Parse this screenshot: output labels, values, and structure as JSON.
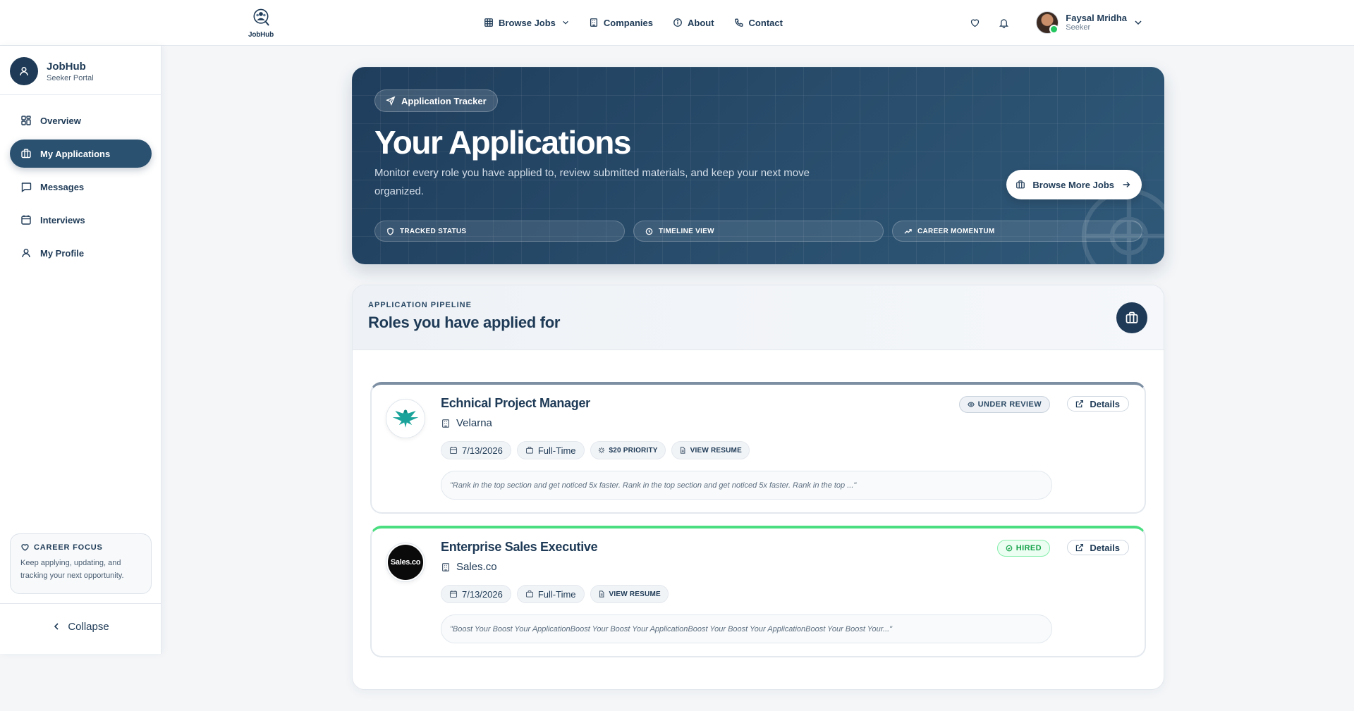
{
  "app": {
    "logo_text": "JobHub"
  },
  "topnav": {
    "links": [
      {
        "label": "Browse Jobs",
        "icon": "grid-icon"
      },
      {
        "label": "Companies",
        "icon": "building-icon"
      },
      {
        "label": "About",
        "icon": "info-icon"
      },
      {
        "label": "Contact",
        "icon": "phone-icon"
      }
    ],
    "user": {
      "name": "Faysal Mridha",
      "role": "Seeker"
    }
  },
  "sidebar": {
    "title": "JobHub",
    "subtitle": "Seeker Portal",
    "items": [
      {
        "label": "Overview",
        "icon": "dashboard-icon",
        "active": false
      },
      {
        "label": "My Applications",
        "icon": "briefcase-icon",
        "active": true
      },
      {
        "label": "Messages",
        "icon": "message-icon",
        "active": false
      },
      {
        "label": "Interviews",
        "icon": "calendar-icon",
        "active": false
      },
      {
        "label": "My Profile",
        "icon": "user-icon",
        "active": false
      }
    ],
    "focus": {
      "title": "CAREER FOCUS",
      "text": "Keep applying, updating, and tracking your next opportunity."
    },
    "collapse_label": "Collapse"
  },
  "hero": {
    "chip": "Application Tracker",
    "title": "Your Applications",
    "description": "Monitor every role you have applied to, review submitted materials, and keep your next move organized.",
    "cta": "Browse More Jobs",
    "pills": [
      "TRACKED STATUS",
      "TIMELINE VIEW",
      "CAREER MOMENTUM"
    ]
  },
  "pipeline": {
    "kicker": "APPLICATION PIPELINE",
    "title": "Roles you have applied for",
    "applications": [
      {
        "title": "Echnical Project Manager",
        "company": "Velarna",
        "date": "7/13/2026",
        "type": "Full-Time",
        "priority": "$20 PRIORITY",
        "resume": "VIEW RESUME",
        "status": "UNDER REVIEW",
        "details": "Details",
        "note": "\"Rank in the top section and get noticed 5x faster. Rank in the top section and get noticed 5x faster. Rank in the top ...\""
      },
      {
        "title": "Enterprise Sales Executive",
        "company": "Sales.co",
        "logo_text": "Sales.co",
        "date": "7/13/2026",
        "type": "Full-Time",
        "resume": "VIEW RESUME",
        "status": "HIRED",
        "details": "Details",
        "note": "\"Boost Your Boost Your ApplicationBoost Your Boost Your ApplicationBoost Your Boost Your ApplicationBoost Your Boost Your...\""
      }
    ]
  },
  "colors": {
    "primary": "#1e3a56",
    "active_nav": "#2b5170",
    "hired": "#16a34a",
    "hired_bar": "#4ade80",
    "review_bar": "#7d8fa3"
  }
}
